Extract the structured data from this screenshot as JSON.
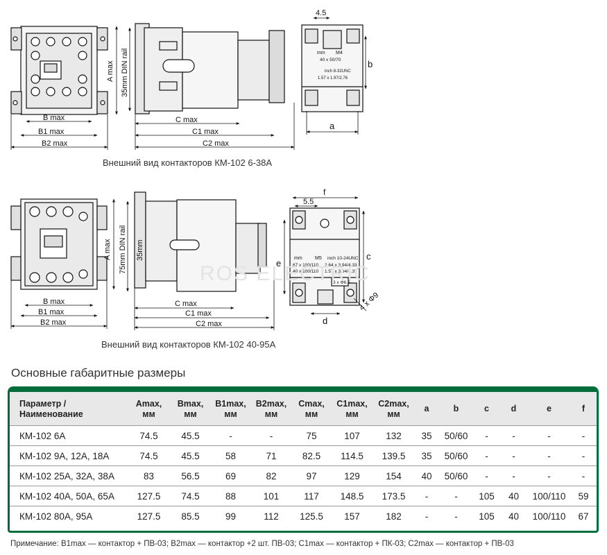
{
  "drawing_1": {
    "caption": "Внешний вид контакторов КМ-102 6-38А",
    "dims": {
      "b_max": "B max",
      "b1_max": "B1 max",
      "b2_max": "B2 max",
      "a_max": "A max",
      "din_rail": "35mm DIN rail",
      "c_max": "C max",
      "c1_max": "C1 max",
      "c2_max": "C2 max",
      "dim_4_5": "4.5",
      "dim_a": "a",
      "dim_b": "b",
      "mm": "mm",
      "m4": "M4",
      "mm_value": "40 x 50/70",
      "inch_label": "inch 8-32UNC",
      "inch_value": "1.57 x 1.97/2.76"
    }
  },
  "drawing_2": {
    "caption": "Внешний вид контакторов КМ-102 40-95А",
    "dims": {
      "b_max": "B max",
      "b1_max": "B1 max",
      "b2_max": "B2 max",
      "a_max": "A max",
      "din_rail": "75mm DIN rail",
      "din_35": "35mm",
      "c_max": "C max",
      "c1_max": "C1 max",
      "c2_max": "C2 max",
      "dim_f": "f",
      "dim_5_5": "5.5",
      "dim_e": "e",
      "dim_c": "c",
      "dim_d": "d",
      "mm": "mm",
      "m5": "M5",
      "inch_label": "inch 10-24UNC",
      "mm_value_1": "67 x 100/110",
      "inch_value_1": "2.64 x 3.94/4.33",
      "mm_value_2": "40 x 100/110",
      "inch_value_2": "1.57 x 3.94/4.33",
      "holes_small": "3 x Φ6.5",
      "holes_large": "4 x Φ9"
    },
    "watermark": "ROS ELECTRIC"
  },
  "section_title": "Основные габаритные размеры",
  "table": {
    "headers": [
      {
        "line1": "Параметр /",
        "line2": "Наименование"
      },
      {
        "line1": "Amax,",
        "line2": "мм"
      },
      {
        "line1": "Bmax,",
        "line2": "мм"
      },
      {
        "line1": "B1max,",
        "line2": "мм"
      },
      {
        "line1": "B2max,",
        "line2": "мм"
      },
      {
        "line1": "Cmax,",
        "line2": "мм"
      },
      {
        "line1": "C1max,",
        "line2": "мм"
      },
      {
        "line1": "C2max,",
        "line2": "мм"
      },
      {
        "line1": "a",
        "line2": ""
      },
      {
        "line1": "b",
        "line2": ""
      },
      {
        "line1": "c",
        "line2": ""
      },
      {
        "line1": "d",
        "line2": ""
      },
      {
        "line1": "e",
        "line2": ""
      },
      {
        "line1": "f",
        "line2": ""
      }
    ],
    "rows": [
      [
        "КМ-102 6А",
        "74.5",
        "45.5",
        "-",
        "-",
        "75",
        "107",
        "132",
        "35",
        "50/60",
        "-",
        "-",
        "-",
        "-"
      ],
      [
        "КМ-102 9А, 12А, 18А",
        "74.5",
        "45.5",
        "58",
        "71",
        "82.5",
        "114.5",
        "139.5",
        "35",
        "50/60",
        "-",
        "-",
        "-",
        "-"
      ],
      [
        "КМ-102 25А, 32А, 38А",
        "83",
        "56.5",
        "69",
        "82",
        "97",
        "129",
        "154",
        "40",
        "50/60",
        "-",
        "-",
        "-",
        "-"
      ],
      [
        "КМ-102 40А, 50А, 65А",
        "127.5",
        "74.5",
        "88",
        "101",
        "117",
        "148.5",
        "173.5",
        "-",
        "-",
        "105",
        "40",
        "100/110",
        "59"
      ],
      [
        "КМ-102 80А, 95А",
        "127.5",
        "85.5",
        "99",
        "112",
        "125.5",
        "157",
        "182",
        "-",
        "-",
        "105",
        "40",
        "100/110",
        "67"
      ]
    ]
  },
  "note": "Примечание:  B1max — контактор + ПВ-03;   B2max — контактор +2 шт. ПВ-03; C1max — контактор + ПК-03;   C2max — контактор + ПВ-03",
  "colors": {
    "accent": "#006e3b",
    "header_bg": "#e8e8e8"
  }
}
